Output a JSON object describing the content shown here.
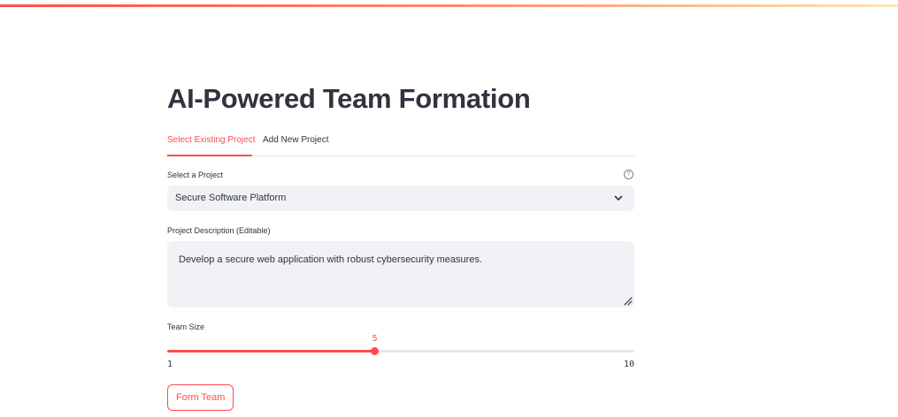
{
  "app": {
    "title": "AI-Powered Team Formation"
  },
  "tabs": [
    {
      "label": "Select Existing Project",
      "active": true
    },
    {
      "label": "Add New Project",
      "active": false
    }
  ],
  "project_select": {
    "label": "Select a Project",
    "help_icon": "question-circle-icon",
    "value": "Secure Software Platform"
  },
  "description": {
    "label": "Project Description (Editable)",
    "value": "Develop a secure web application with robust cybersecurity measures."
  },
  "team_size": {
    "label": "Team Size",
    "value": "5",
    "min": "1",
    "max": "10"
  },
  "form_button": {
    "label": "Form Team"
  },
  "colors": {
    "accent": "#ff4b4b",
    "input_bg": "#f0f2f6",
    "text": "#31333f"
  }
}
